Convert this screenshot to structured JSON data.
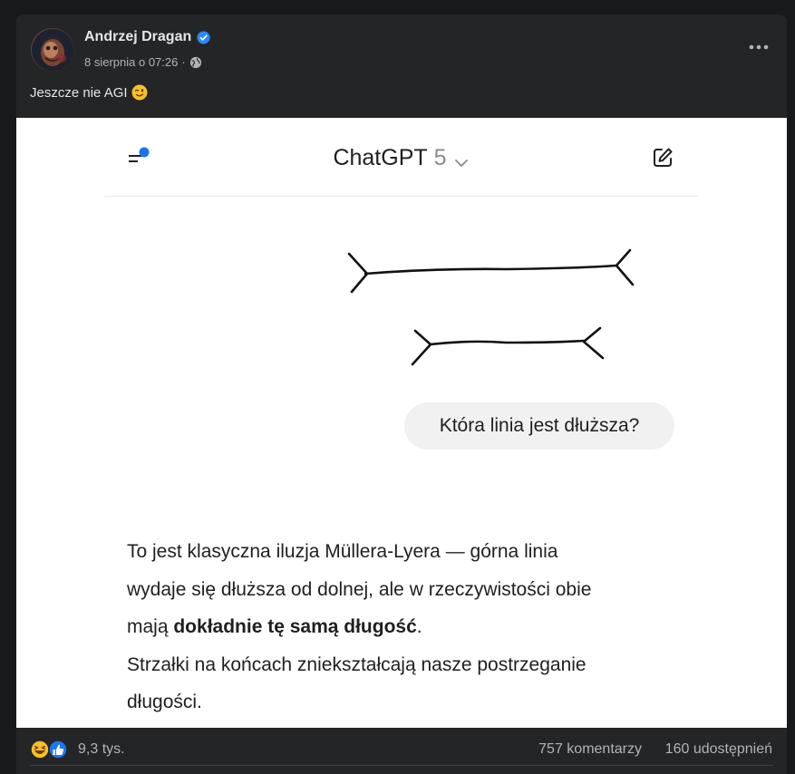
{
  "post": {
    "author": "Andrzej Dragan",
    "timestamp": "8 sierpnia o 07:26",
    "separator": "·",
    "text": "Jeszcze nie AGI",
    "icons": {
      "avatar": "avatar",
      "verified": "verified-badge-icon",
      "audience": "globe-icon",
      "more": "more-options-icon",
      "emoji": "winking-face-emoji"
    }
  },
  "screenshot": {
    "header": {
      "title": "ChatGPT",
      "version": "5",
      "icons": {
        "menu": "menu-icon",
        "dropdown": "chevron-down-icon",
        "new_chat": "edit-icon"
      }
    },
    "user_message": "Która linia jest dłuższa?",
    "answer": {
      "line1": "To jest klasyczna iluzja Müllera-Lyera — górna linia",
      "line2": "wydaje się dłuższa od dolnej, ale w rzeczywistości obie",
      "line3_prefix": "mają ",
      "line3_bold": "dokładnie tę samą długość",
      "line3_suffix": ".",
      "line4": "Strzałki na końcach zniekształcają nasze postrzeganie",
      "line5": "długości."
    }
  },
  "stats": {
    "reactions_count": "9,3 tys.",
    "comments": "757 komentarzy",
    "shares": "160 udostępnień",
    "reaction_types": [
      "haha",
      "like"
    ]
  },
  "colors": {
    "background": "#18191a",
    "card": "#242526",
    "primary_text": "#e4e6eb",
    "secondary_text": "#b0b3b8",
    "verified_blue": "#2d88ff",
    "menu_dot_blue": "#1a73e8"
  }
}
